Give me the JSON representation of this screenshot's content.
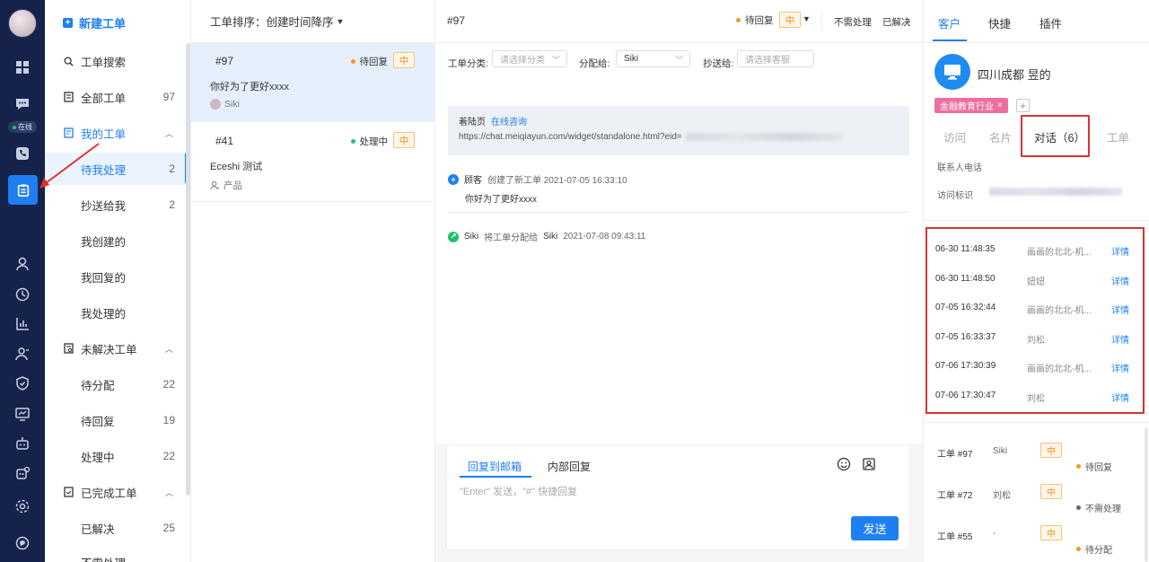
{
  "rail": {
    "online_label": "在线",
    "icons": [
      "dashboard-icon",
      "chat-icon",
      "phone-icon",
      "ticket-icon",
      "user-icon",
      "clock-icon",
      "chart-icon",
      "contacts-icon",
      "shield-icon",
      "monitor-icon",
      "robot-icon",
      "bot-settings-icon",
      "settings-icon",
      "message-icon"
    ]
  },
  "nav": {
    "new_ticket": "新建工单",
    "search": "工单搜索",
    "all": {
      "label": "全部工单",
      "count": "97"
    },
    "mine": {
      "label": "我的工单"
    },
    "pending_me": {
      "label": "待我处理",
      "count": "2"
    },
    "cc_me": {
      "label": "抄送给我",
      "count": "2"
    },
    "created": {
      "label": "我创建的"
    },
    "replied": {
      "label": "我回复的"
    },
    "handled": {
      "label": "我处理的"
    },
    "unresolved": {
      "label": "未解决工单"
    },
    "to_assign": {
      "label": "待分配",
      "count": "22"
    },
    "to_reply": {
      "label": "待回复",
      "count": "19"
    },
    "processing": {
      "label": "处理中",
      "count": "22"
    },
    "done": {
      "label": "已完成工单"
    },
    "resolved": {
      "label": "已解决",
      "count": "25"
    },
    "no_need": {
      "label": "不需处理"
    }
  },
  "list": {
    "sort_label": "工单排序：",
    "sort_value": "创建时间降序",
    "tickets": [
      {
        "id": "#97",
        "status": "待回复",
        "status_color": "#f59a23",
        "priority": "中",
        "title": "你好为了更好xxxx",
        "who": "Siki"
      },
      {
        "id": "#41",
        "status": "处理中",
        "status_color": "#23c06a",
        "priority": "中",
        "title": "Eceshi 测试",
        "who": "产品"
      }
    ]
  },
  "detail": {
    "number": "#97",
    "status": "待回复",
    "priority": "中",
    "btn_no_need": "不需处理",
    "btn_resolved": "已解决",
    "f_category": "工单分类:",
    "f_category_ph": "请选择分类",
    "f_assign": "分配给:",
    "f_assign_val": "Siki",
    "f_cc": "抄送给:",
    "f_cc_ph": "请选择客服",
    "landing_label": "着陆页",
    "landing_link": "在线咨询",
    "landing_url": "https://chat.meiqiayun.com/widget/standalone.html?eid=",
    "ev1_actor": "顾客",
    "ev1_text": "创建了新工单 2021-07-05 16:33:10",
    "ev1_msg": "你好为了更好xxxx",
    "ev2_actor": "Siki",
    "ev2_text": "将工单分配给",
    "ev2_target": "Siki",
    "ev2_time": "2021-07-08 09:43:11",
    "reply_tab_email": "回复到邮箱",
    "reply_tab_internal": "内部回复",
    "reply_placeholder": "\"Enter\" 发送，\"#\" 快捷回复",
    "send": "发送"
  },
  "right": {
    "tab_customer": "客户",
    "tab_quick": "快捷",
    "tab_plugin": "插件",
    "customer_name": "四川成都 昱的",
    "industry_tag": "金融教育行业",
    "sub_visit": "访问",
    "sub_card": "名片",
    "sub_conv": "对话（6）",
    "sub_ticket": "工单",
    "info_phone": "联系人电话",
    "info_visit_id": "访问标识",
    "conversations": [
      {
        "time": "06-30 11:48:35",
        "agent": "画画的北北-机...",
        "detail": "详情"
      },
      {
        "time": "06-30 11:48:50",
        "agent": "妞妞",
        "detail": "详情"
      },
      {
        "time": "07-05 16:32:44",
        "agent": "画画的北北-机...",
        "detail": "详情"
      },
      {
        "time": "07-05 16:33:37",
        "agent": "刘松",
        "detail": "详情"
      },
      {
        "time": "07-06 17:30:39",
        "agent": "画画的北北-机...",
        "detail": "详情"
      },
      {
        "time": "07-06 17:30:47",
        "agent": "刘松",
        "detail": "详情"
      }
    ],
    "history": [
      {
        "ticket": "工单 #97",
        "who": "Siki",
        "priority": "中",
        "status": "待回复",
        "status_color": "#f59a23"
      },
      {
        "ticket": "工单 #72",
        "who": "刘松",
        "priority": "中",
        "status": "不需处理",
        "status_color": "#666666"
      },
      {
        "ticket": "工单 #55",
        "who": "-",
        "priority": "中",
        "status": "待分配",
        "status_color": "#f59a23"
      }
    ]
  }
}
